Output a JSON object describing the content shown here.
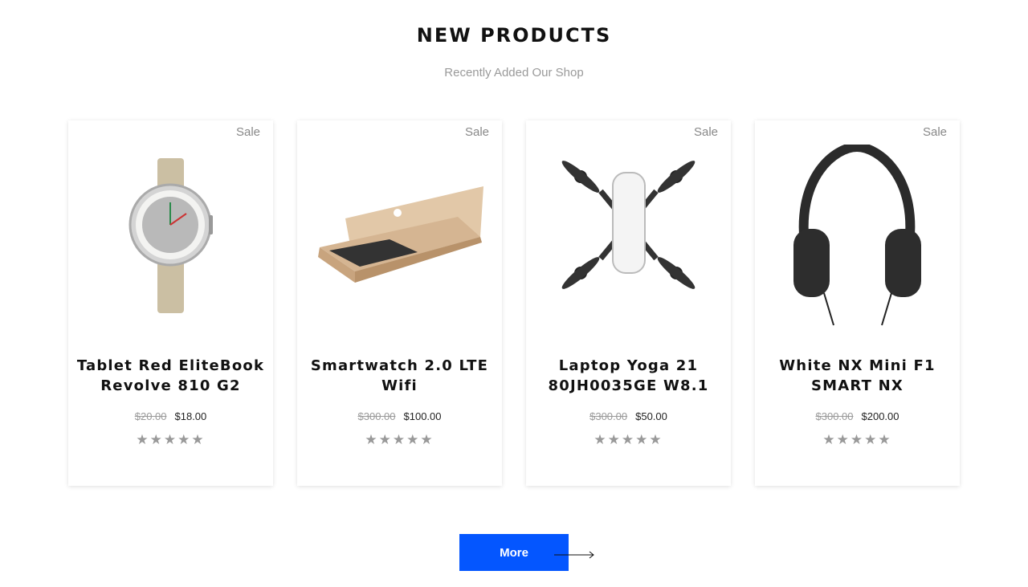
{
  "header": {
    "title": "NEW PRODUCTS",
    "subtitle": "Recently Added Our Shop"
  },
  "products": [
    {
      "badge": "Sale",
      "title": "Tablet Red EliteBook Revolve 810 G2",
      "old_price": "$20.00",
      "price": "$18.00",
      "rating_stars": "★★★★★",
      "image_icon": "smartwatch-image"
    },
    {
      "badge": "Sale",
      "title": "Smartwatch 2.0 LTE Wifi",
      "old_price": "$300.00",
      "price": "$100.00",
      "rating_stars": "★★★★★",
      "image_icon": "laptop-image"
    },
    {
      "badge": "Sale",
      "title": "Laptop Yoga 21 80JH0035GE W8.1",
      "old_price": "$300.00",
      "price": "$50.00",
      "rating_stars": "★★★★★",
      "image_icon": "drone-image"
    },
    {
      "badge": "Sale",
      "title": "White NX Mini F1 SMART NX",
      "old_price": "$300.00",
      "price": "$200.00",
      "rating_stars": "★★★★★",
      "image_icon": "headphones-image"
    }
  ],
  "more_button": {
    "label": "More"
  },
  "colors": {
    "accent": "#0456ff",
    "muted": "#999999"
  }
}
